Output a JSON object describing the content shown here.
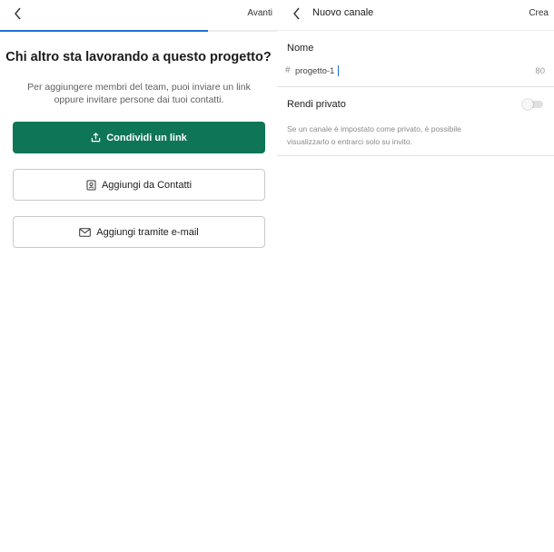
{
  "invite_screen": {
    "next_label": "Avanti",
    "progress_fraction": 0.75,
    "heading": "Chi altro sta lavorando a questo progetto?",
    "description": "Per aggiungere membri del team, puoi inviare un link oppure invitare persone dai tuoi contatti.",
    "share_link_label": "Condividi un link",
    "add_contacts_label": "Aggiungi da Contatti",
    "add_email_label": "Aggiungi tramite e-mail",
    "primary_color": "#0f7557",
    "progress_color": "#1f6fd6"
  },
  "new_channel": {
    "title": "Nuovo canale",
    "create_label": "Crea",
    "name_label": "Nome",
    "hash_symbol": "#",
    "name_value": "progetto-1",
    "char_counter": "80",
    "private_label": "Rendi privato",
    "private_enabled": false,
    "private_description": "Se un canale è impostato come privato, è possibile visualizzarlo o entrarci solo su invito."
  },
  "icons": {
    "back": "chevron-left-icon",
    "share": "share-icon",
    "contacts": "contact-card-icon",
    "email": "envelope-icon"
  }
}
